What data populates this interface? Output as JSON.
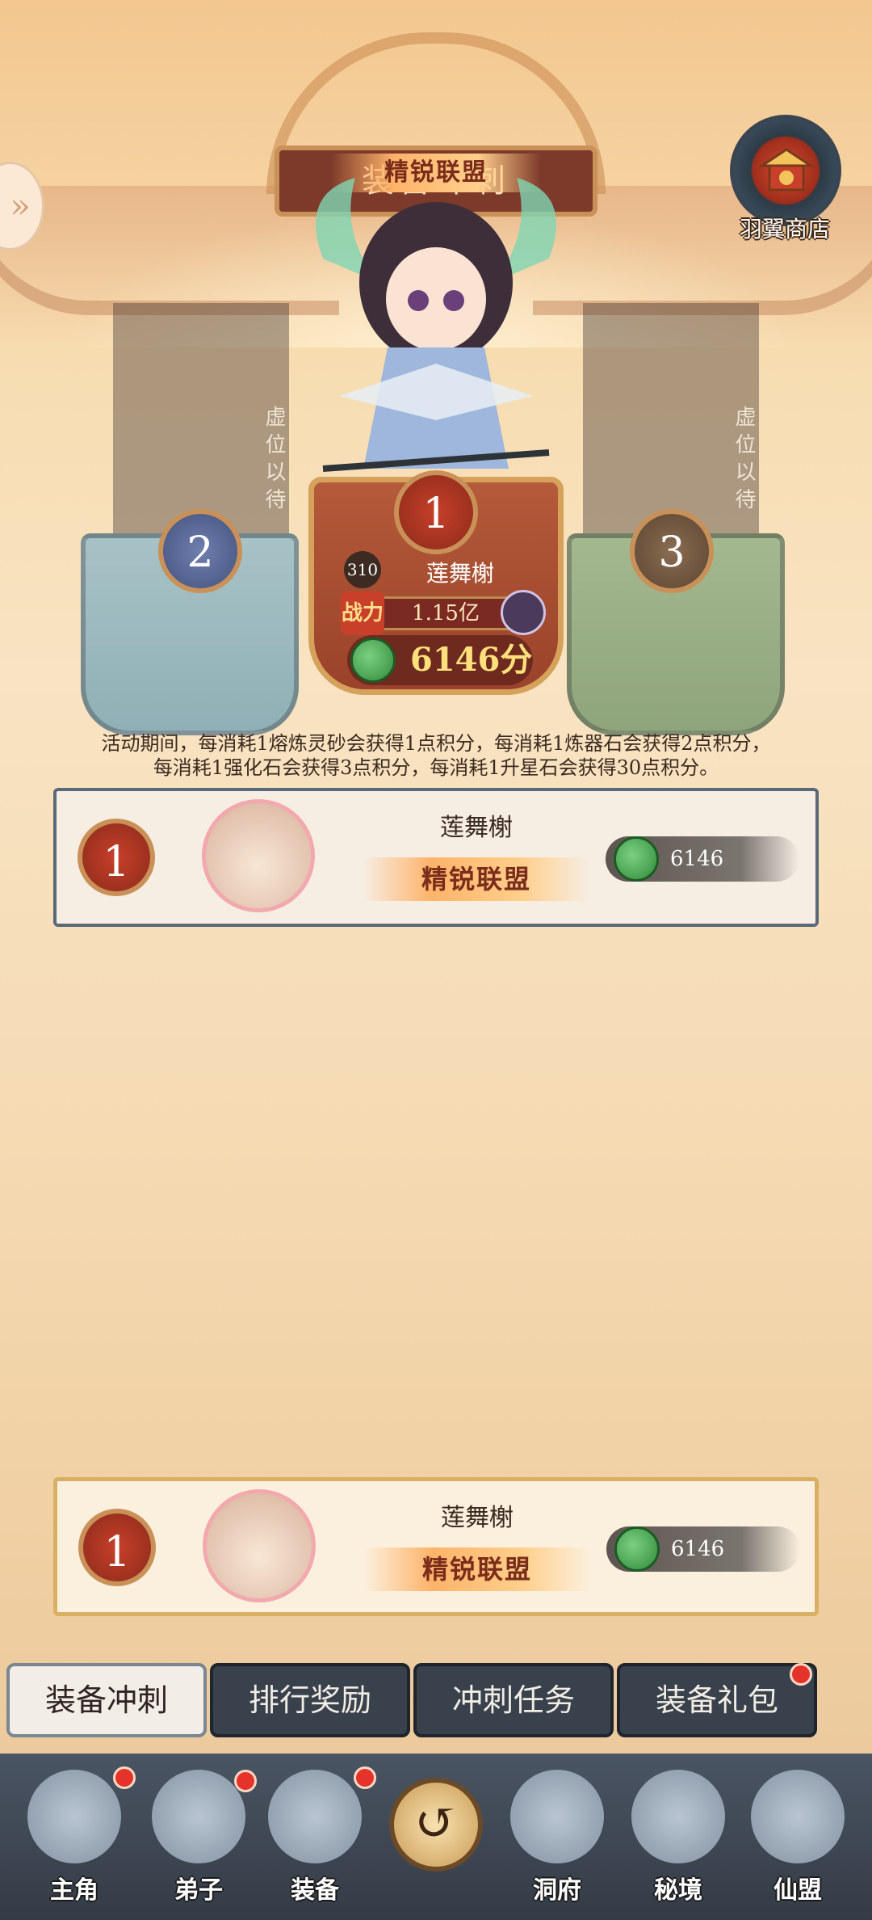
{
  "event": {
    "title": "装备冲刺",
    "alliance": "精锐联盟"
  },
  "shop": {
    "label": "羽翼商店"
  },
  "podium": {
    "first": {
      "rank": "1",
      "level": "310",
      "name": "莲舞榭",
      "power_tag": "战力",
      "power": "1.15亿",
      "score": "6146分"
    },
    "second": {
      "rank": "2",
      "vacant": "虚位以待"
    },
    "third": {
      "rank": "3",
      "vacant": "虚位以待"
    }
  },
  "rules": {
    "line1": "活动期间，每消耗1熔炼灵砂会获得1点积分，每消耗1炼器石会获得2点积分，",
    "line2": "每消耗1强化石会获得3点积分，每消耗1升星石会获得30点积分。"
  },
  "ranking": [
    {
      "rank": "1",
      "name": "莲舞榭",
      "alliance": "精锐联盟",
      "score": "6146"
    }
  ],
  "my_rank": {
    "rank": "1",
    "name": "莲舞榭",
    "alliance": "精锐联盟",
    "score": "6146"
  },
  "tabs": [
    {
      "label": "装备冲刺",
      "active": true
    },
    {
      "label": "排行奖励"
    },
    {
      "label": "冲刺任务"
    },
    {
      "label": "装备礼包",
      "badge": true
    }
  ],
  "nav": [
    {
      "label": "主角",
      "badge": true
    },
    {
      "label": "弟子",
      "badge": true
    },
    {
      "label": "装备",
      "badge": true
    },
    {
      "label": "洞府"
    },
    {
      "label": "秘境"
    },
    {
      "label": "仙盟"
    }
  ],
  "colors": {
    "accent_red": "#c8402a",
    "badge_red": "#e5322a",
    "tab_dark": "#38414c",
    "score_green": "#2f8a3a"
  }
}
